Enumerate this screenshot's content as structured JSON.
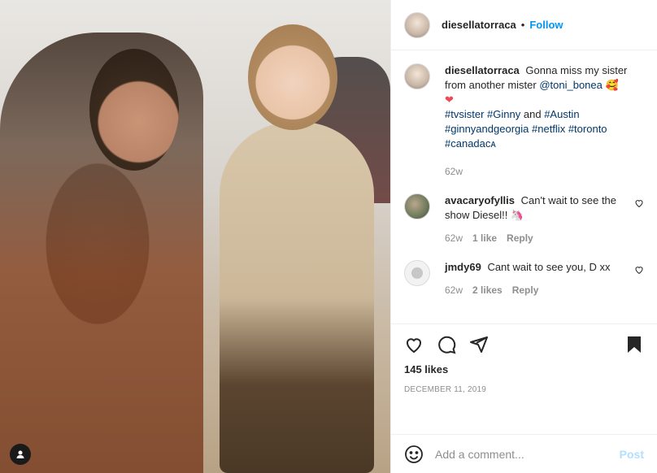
{
  "header": {
    "username": "diesellatorraca",
    "separator": "•",
    "follow_label": "Follow"
  },
  "caption": {
    "username": "diesellatorraca",
    "text": "Gonna miss my sister from another mister",
    "mention": "@toni_bonea",
    "emoji1": "🥰",
    "emoji2": "❤",
    "hashtags_line1_a": "#tvsister",
    "hashtags_line1_b": "#Ginny",
    "and_word": "and",
    "hashtags_line1_c": "#Austin",
    "hashtags_line2_a": "#ginnyandgeorgia",
    "hashtags_line2_b": "#netflix",
    "hashtags_line2_c": "#toronto",
    "hashtags_line3": "#canadaᴄᴀ",
    "time": "62w"
  },
  "comments": [
    {
      "username": "avacaryofyllis",
      "text": "Can't wait to see the show Diesel!! 🦄",
      "time": "62w",
      "likes": "1 like",
      "reply": "Reply"
    },
    {
      "username": "jmdy69",
      "text": "Cant wait to see you, D xx",
      "time": "62w",
      "likes": "2 likes",
      "reply": "Reply"
    }
  ],
  "actions": {
    "likes": "145 likes",
    "date": "DECEMBER 11, 2019"
  },
  "add_comment": {
    "placeholder": "Add a comment...",
    "post_label": "Post"
  },
  "icons": [
    "heart-icon",
    "comment-icon",
    "share-icon",
    "bookmark-icon",
    "emoji-icon",
    "user-tag-icon"
  ],
  "colors": {
    "link": "#00376b",
    "follow": "#0095f6",
    "post_disabled": "#b2dffc",
    "heart": "#ed4956"
  }
}
